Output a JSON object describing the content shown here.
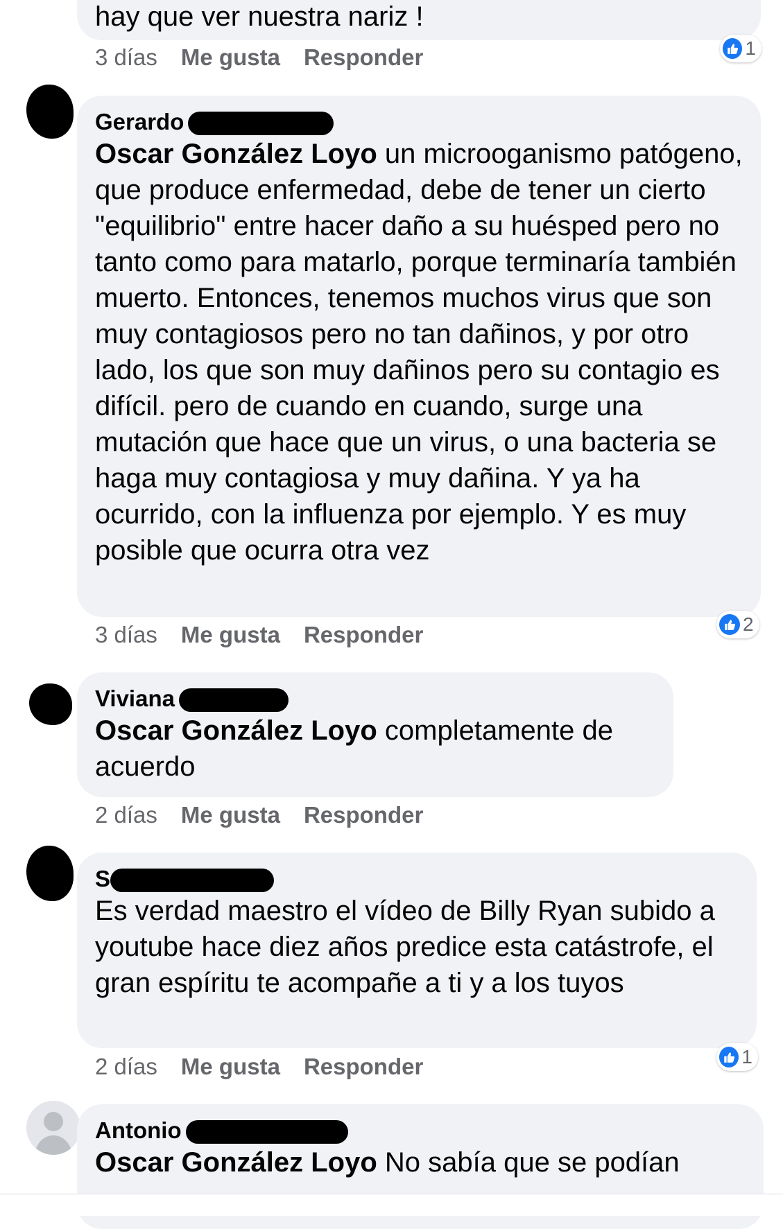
{
  "comments": [
    {
      "author": "",
      "mention": "",
      "text": "hay que ver nuestra nariz !",
      "time": "3 días",
      "like_label": "Me gusta",
      "reply_label": "Responder",
      "reactions": "1"
    },
    {
      "author": "Gerardo",
      "mention": "Oscar González Loyo",
      "text": " un microoganismo patógeno, que produce enfermedad, debe de tener un cierto \"equilibrio\" entre hacer daño a su huésped pero no tanto como para matarlo, porque terminaría también muerto. Entonces, tenemos muchos virus que son muy contagiosos pero no tan dañinos, y por otro lado, los que son muy dañinos pero su contagio es  difícil. pero de cuando en cuando, surge una mutación que hace que un virus, o una bacteria se haga muy contagiosa y muy dañina. Y ya ha ocurrido, con la influenza por ejemplo. Y es muy posible que ocurra otra vez",
      "time": "3 días",
      "like_label": "Me gusta",
      "reply_label": "Responder",
      "reactions": "2"
    },
    {
      "author": "Viviana",
      "mention": "Oscar González Loyo",
      "text": " completamente de acuerdo",
      "time": "2 días",
      "like_label": "Me gusta",
      "reply_label": "Responder",
      "reactions": ""
    },
    {
      "author": "S",
      "mention": "",
      "text": "Es verdad maestro el vídeo de Billy Ryan subido a youtube hace diez años predice esta catástrofe, el gran espíritu te acompañe a ti y a los tuyos",
      "time": "2 días",
      "like_label": "Me gusta",
      "reply_label": "Responder",
      "reactions": "1"
    },
    {
      "author": "Antonio",
      "mention": "Oscar González Loyo",
      "text": " No sabía que se podían",
      "time": "",
      "like_label": "",
      "reply_label": "",
      "reactions": ""
    }
  ],
  "colors": {
    "bubble": "#f0f2f5",
    "meta": "#65676b",
    "like_blue": "#1877f2"
  },
  "icons": [
    "like-thumb-icon",
    "default-avatar-icon"
  ]
}
